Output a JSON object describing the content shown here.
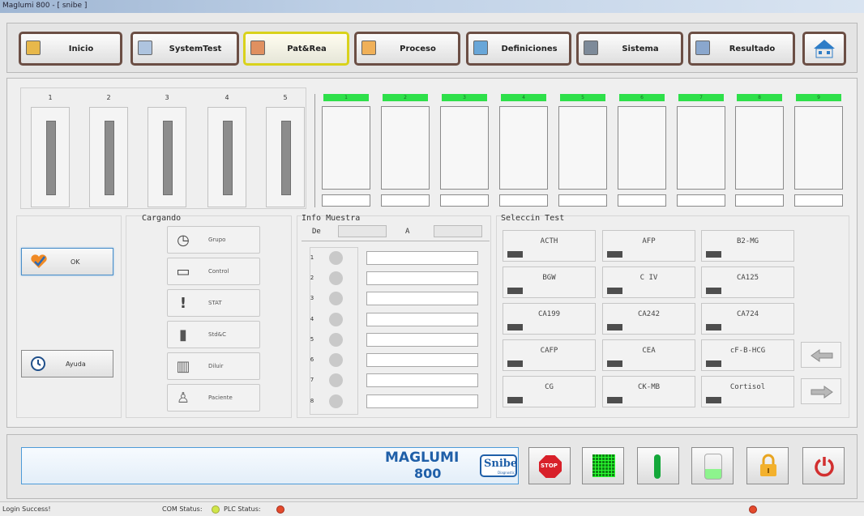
{
  "window": {
    "title": "Maglumi 800 - [ snibe ]"
  },
  "nav": [
    {
      "label": "Inicio",
      "icon": "inicio-icon",
      "color": "#d8a83a"
    },
    {
      "label": "SystemTest",
      "icon": "system-test-icon",
      "color": "#7a99c4"
    },
    {
      "label": "Pat&Rea",
      "icon": "patients-icon",
      "color": "#d88858"
    },
    {
      "label": "Proceso",
      "icon": "process-icon",
      "color": "#e9a84e"
    },
    {
      "label": "Definiciones",
      "icon": "definitions-icon",
      "color": "#4e8ec4"
    },
    {
      "label": "Sistema",
      "icon": "system-icon",
      "color": "#6e7b8a"
    },
    {
      "label": "Resultado",
      "icon": "result-icon",
      "color": "#6789b3"
    }
  ],
  "racks": [
    "1",
    "2",
    "3",
    "4",
    "5"
  ],
  "reagents": [
    "1",
    "2",
    "3",
    "4",
    "5",
    "6",
    "7",
    "8",
    "9"
  ],
  "buttons": {
    "ok": "OK",
    "help": "Ayuda"
  },
  "cargando": {
    "title": "Cargando",
    "items": [
      "Grupo",
      "Control",
      "STAT",
      "Std&C",
      "Diluir",
      "Paciente"
    ]
  },
  "info": {
    "title": "Info Muestra",
    "from": "De",
    "to": "A",
    "rows": [
      "1",
      "2",
      "3",
      "4",
      "5",
      "6",
      "7",
      "8"
    ]
  },
  "tests": {
    "title": "Seleccin Test",
    "items": [
      "ACTH",
      "AFP",
      "B2-MG",
      "BGW",
      "C IV",
      "CA125",
      "CA199",
      "CA242",
      "CA724",
      "CAFP",
      "CEA",
      "cF-B-HCG",
      "CG",
      "CK-MB",
      "Cortisol"
    ]
  },
  "brand": {
    "name": "MAGLUMI",
    "model": "800",
    "logo": "Snibe",
    "sub": "Diagnostic"
  },
  "bottom": {
    "stop": "STOP"
  },
  "status": {
    "message": "Login Success!",
    "com": "COM Status:",
    "plc": "PLC Status:"
  },
  "colors": {
    "green": "#2ee04a",
    "stop_red": "#d8202a",
    "border_brown": "#6b4e44",
    "active": "#d9d21b"
  }
}
